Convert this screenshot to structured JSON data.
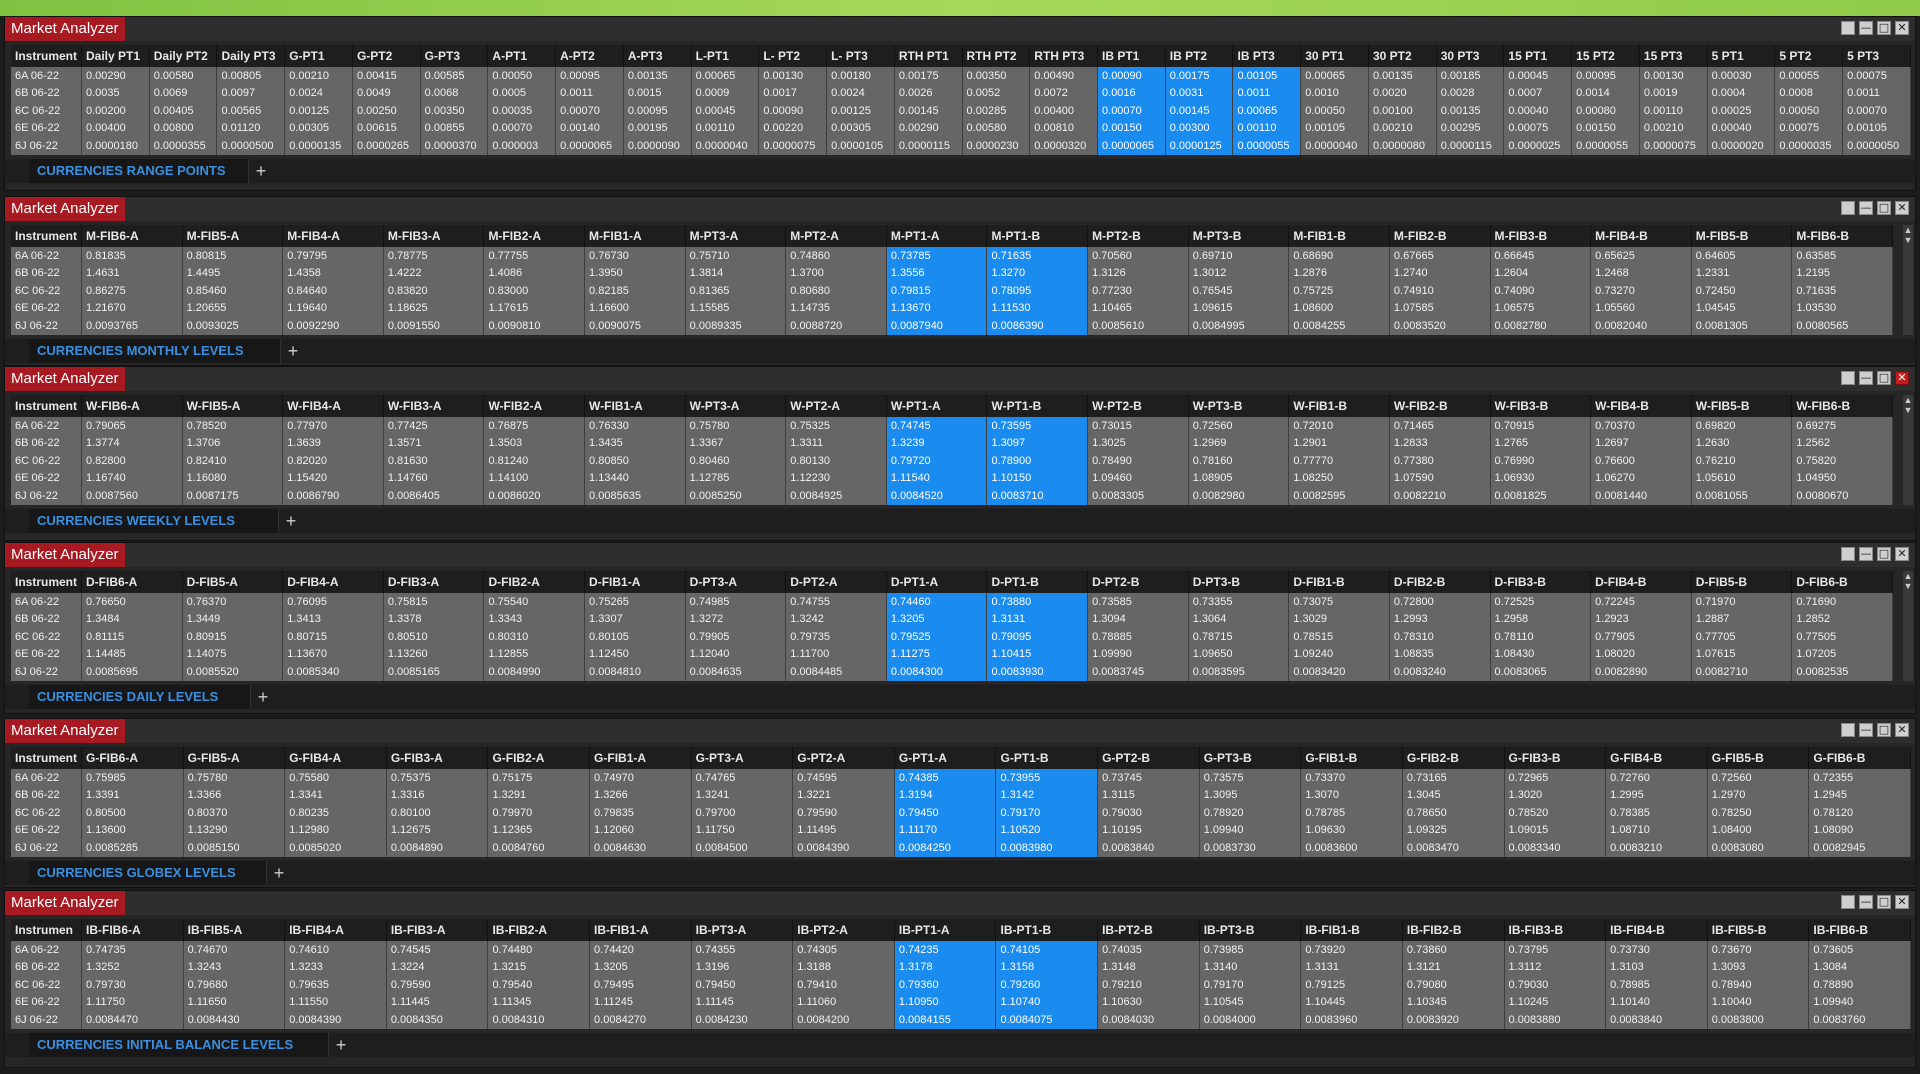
{
  "window_title": "Market Analyzer",
  "window_buttons": [
    "restore-icon",
    "minimize-icon",
    "maximize-icon",
    "close-icon"
  ],
  "panels": [
    {
      "tab": "CURRENCIES RANGE POINTS",
      "columns": [
        "Instrument",
        "Daily PT1",
        "Daily PT2",
        "Daily PT3",
        "G-PT1",
        "G-PT2",
        "G-PT3",
        "A-PT1",
        "A-PT2",
        "A-PT3",
        "L-PT1",
        "L- PT2",
        "L- PT3",
        "RTH PT1",
        "RTH PT2",
        "RTH PT3",
        "IB PT1",
        "IB PT2",
        "IB PT3",
        "30 PT1",
        "30 PT2",
        "30 PT3",
        "15 PT1",
        "15 PT2",
        "15 PT3",
        "5 PT1",
        "5 PT2",
        "5 PT3"
      ],
      "highlight_cols": [
        16,
        17,
        18
      ],
      "rows": [
        [
          "6A 06-22",
          "0.00290",
          "0.00580",
          "0.00805",
          "0.00210",
          "0.00415",
          "0.00585",
          "0.00050",
          "0.00095",
          "0.00135",
          "0.00065",
          "0.00130",
          "0.00180",
          "0.00175",
          "0.00350",
          "0.00490",
          "0.00090",
          "0.00175",
          "0.00105",
          "0.00065",
          "0.00135",
          "0.00185",
          "0.00045",
          "0.00095",
          "0.00130",
          "0.00030",
          "0.00055",
          "0.00075"
        ],
        [
          "6B 06-22",
          "0.0035",
          "0.0069",
          "0.0097",
          "0.0024",
          "0.0049",
          "0.0068",
          "0.0005",
          "0.0011",
          "0.0015",
          "0.0009",
          "0.0017",
          "0.0024",
          "0.0026",
          "0.0052",
          "0.0072",
          "0.0016",
          "0.0031",
          "0.0011",
          "0.0010",
          "0.0020",
          "0.0028",
          "0.0007",
          "0.0014",
          "0.0019",
          "0.0004",
          "0.0008",
          "0.0011"
        ],
        [
          "6C 06-22",
          "0.00200",
          "0.00405",
          "0.00565",
          "0.00125",
          "0.00250",
          "0.00350",
          "0.00035",
          "0.00070",
          "0.00095",
          "0.00045",
          "0.00090",
          "0.00125",
          "0.00145",
          "0.00285",
          "0.00400",
          "0.00070",
          "0.00145",
          "0.00065",
          "0.00050",
          "0.00100",
          "0.00135",
          "0.00040",
          "0.00080",
          "0.00110",
          "0.00025",
          "0.00050",
          "0.00070"
        ],
        [
          "6E 06-22",
          "0.00400",
          "0.00800",
          "0.01120",
          "0.00305",
          "0.00615",
          "0.00855",
          "0.00070",
          "0.00140",
          "0.00195",
          "0.00110",
          "0.00220",
          "0.00305",
          "0.00290",
          "0.00580",
          "0.00810",
          "0.00150",
          "0.00300",
          "0.00110",
          "0.00105",
          "0.00210",
          "0.00295",
          "0.00075",
          "0.00150",
          "0.00210",
          "0.00040",
          "0.00075",
          "0.00105"
        ],
        [
          "6J 06-22",
          "0.0000180",
          "0.0000355",
          "0.0000500",
          "0.0000135",
          "0.0000265",
          "0.0000370",
          "0.000003",
          "0.0000065",
          "0.0000090",
          "0.0000040",
          "0.0000075",
          "0.0000105",
          "0.0000115",
          "0.0000230",
          "0.0000320",
          "0.0000065",
          "0.0000125",
          "0.0000055",
          "0.0000040",
          "0.0000080",
          "0.0000115",
          "0.0000025",
          "0.0000055",
          "0.0000075",
          "0.0000020",
          "0.0000035",
          "0.0000050"
        ]
      ]
    },
    {
      "tab": "CURRENCIES MONTHLY LEVELS",
      "columns": [
        "Instrument",
        "M-FIB6-A",
        "M-FIB5-A",
        "M-FIB4-A",
        "M-FIB3-A",
        "M-FIB2-A",
        "M-FIB1-A",
        "M-PT3-A",
        "M-PT2-A",
        "M-PT1-A",
        "M-PT1-B",
        "M-PT2-B",
        "M-PT3-B",
        "M-FIB1-B",
        "M-FIB2-B",
        "M-FIB3-B",
        "M-FIB4-B",
        "M-FIB5-B",
        "M-FIB6-B"
      ],
      "highlight_cols": [
        9,
        10
      ],
      "rows": [
        [
          "6A 06-22",
          "0.81835",
          "0.80815",
          "0.79795",
          "0.78775",
          "0.77755",
          "0.76730",
          "0.75710",
          "0.74860",
          "0.73785",
          "0.71635",
          "0.70560",
          "0.69710",
          "0.68690",
          "0.67665",
          "0.66645",
          "0.65625",
          "0.64605",
          "0.63585"
        ],
        [
          "6B 06-22",
          "1.4631",
          "1.4495",
          "1.4358",
          "1.4222",
          "1.4086",
          "1.3950",
          "1.3814",
          "1.3700",
          "1.3556",
          "1.3270",
          "1.3126",
          "1.3012",
          "1.2876",
          "1.2740",
          "1.2604",
          "1.2468",
          "1.2331",
          "1.2195"
        ],
        [
          "6C 06-22",
          "0.86275",
          "0.85460",
          "0.84640",
          "0.83820",
          "0.83000",
          "0.82185",
          "0.81365",
          "0.80680",
          "0.79815",
          "0.78095",
          "0.77230",
          "0.76545",
          "0.75725",
          "0.74910",
          "0.74090",
          "0.73270",
          "0.72450",
          "0.71635"
        ],
        [
          "6E 06-22",
          "1.21670",
          "1.20655",
          "1.19640",
          "1.18625",
          "1.17615",
          "1.16600",
          "1.15585",
          "1.14735",
          "1.13670",
          "1.11530",
          "1.10465",
          "1.09615",
          "1.08600",
          "1.07585",
          "1.06575",
          "1.05560",
          "1.04545",
          "1.03530"
        ],
        [
          "6J 06-22",
          "0.0093765",
          "0.0093025",
          "0.0092290",
          "0.0091550",
          "0.0090810",
          "0.0090075",
          "0.0089335",
          "0.0088720",
          "0.0087940",
          "0.0086390",
          "0.0085610",
          "0.0084995",
          "0.0084255",
          "0.0083520",
          "0.0082780",
          "0.0082040",
          "0.0081305",
          "0.0080565"
        ]
      ]
    },
    {
      "tab": "CURRENCIES WEEKLY LEVELS",
      "columns": [
        "Instrument",
        "W-FIB6-A",
        "W-FIB5-A",
        "W-FIB4-A",
        "W-FIB3-A",
        "W-FIB2-A",
        "W-FIB1-A",
        "W-PT3-A",
        "W-PT2-A",
        "W-PT1-A",
        "W-PT1-B",
        "W-PT2-B",
        "W-PT3-B",
        "W-FIB1-B",
        "W-FIB2-B",
        "W-FIB3-B",
        "W-FIB4-B",
        "W-FIB5-B",
        "W-FIB6-B"
      ],
      "highlight_cols": [
        9,
        10
      ],
      "rows": [
        [
          "6A 06-22",
          "0.79065",
          "0.78520",
          "0.77970",
          "0.77425",
          "0.76875",
          "0.76330",
          "0.75780",
          "0.75325",
          "0.74745",
          "0.73595",
          "0.73015",
          "0.72560",
          "0.72010",
          "0.71465",
          "0.70915",
          "0.70370",
          "0.69820",
          "0.69275"
        ],
        [
          "6B 06-22",
          "1.3774",
          "1.3706",
          "1.3639",
          "1.3571",
          "1.3503",
          "1.3435",
          "1.3367",
          "1.3311",
          "1.3239",
          "1.3097",
          "1.3025",
          "1.2969",
          "1.2901",
          "1.2833",
          "1.2765",
          "1.2697",
          "1.2630",
          "1.2562"
        ],
        [
          "6C 06-22",
          "0.82800",
          "0.82410",
          "0.82020",
          "0.81630",
          "0.81240",
          "0.80850",
          "0.80460",
          "0.80130",
          "0.79720",
          "0.78900",
          "0.78490",
          "0.78160",
          "0.77770",
          "0.77380",
          "0.76990",
          "0.76600",
          "0.76210",
          "0.75820"
        ],
        [
          "6E 06-22",
          "1.16740",
          "1.16080",
          "1.15420",
          "1.14760",
          "1.14100",
          "1.13440",
          "1.12785",
          "1.12230",
          "1.11540",
          "1.10150",
          "1.09460",
          "1.08905",
          "1.08250",
          "1.07590",
          "1.06930",
          "1.06270",
          "1.05610",
          "1.04950"
        ],
        [
          "6J 06-22",
          "0.0087560",
          "0.0087175",
          "0.0086790",
          "0.0086405",
          "0.0086020",
          "0.0085635",
          "0.0085250",
          "0.0084925",
          "0.0084520",
          "0.0083710",
          "0.0083305",
          "0.0082980",
          "0.0082595",
          "0.0082210",
          "0.0081825",
          "0.0081440",
          "0.0081055",
          "0.0080670"
        ]
      ]
    },
    {
      "tab": "CURRENCIES DAILY LEVELS",
      "columns": [
        "Instrument",
        "D-FIB6-A",
        "D-FIB5-A",
        "D-FIB4-A",
        "D-FIB3-A",
        "D-FIB2-A",
        "D-FIB1-A",
        "D-PT3-A",
        "D-PT2-A",
        "D-PT1-A",
        "D-PT1-B",
        "D-PT2-B",
        "D-PT3-B",
        "D-FIB1-B",
        "D-FIB2-B",
        "D-FIB3-B",
        "D-FIB4-B",
        "D-FIB5-B",
        "D-FIB6-B"
      ],
      "highlight_cols": [
        9,
        10
      ],
      "rows": [
        [
          "6A 06-22",
          "0.76650",
          "0.76370",
          "0.76095",
          "0.75815",
          "0.75540",
          "0.75265",
          "0.74985",
          "0.74755",
          "0.74460",
          "0.73880",
          "0.73585",
          "0.73355",
          "0.73075",
          "0.72800",
          "0.72525",
          "0.72245",
          "0.71970",
          "0.71690"
        ],
        [
          "6B 06-22",
          "1.3484",
          "1.3449",
          "1.3413",
          "1.3378",
          "1.3343",
          "1.3307",
          "1.3272",
          "1.3242",
          "1.3205",
          "1.3131",
          "1.3094",
          "1.3064",
          "1.3029",
          "1.2993",
          "1.2958",
          "1.2923",
          "1.2887",
          "1.2852"
        ],
        [
          "6C 06-22",
          "0.81115",
          "0.80915",
          "0.80715",
          "0.80510",
          "0.80310",
          "0.80105",
          "0.79905",
          "0.79735",
          "0.79525",
          "0.79095",
          "0.78885",
          "0.78715",
          "0.78515",
          "0.78310",
          "0.78110",
          "0.77905",
          "0.77705",
          "0.77505"
        ],
        [
          "6E 06-22",
          "1.14485",
          "1.14075",
          "1.13670",
          "1.13260",
          "1.12855",
          "1.12450",
          "1.12040",
          "1.11700",
          "1.11275",
          "1.10415",
          "1.09990",
          "1.09650",
          "1.09240",
          "1.08835",
          "1.08430",
          "1.08020",
          "1.07615",
          "1.07205"
        ],
        [
          "6J 06-22",
          "0.0085695",
          "0.0085520",
          "0.0085340",
          "0.0085165",
          "0.0084990",
          "0.0084810",
          "0.0084635",
          "0.0084485",
          "0.0084300",
          "0.0083930",
          "0.0083745",
          "0.0083595",
          "0.0083420",
          "0.0083240",
          "0.0083065",
          "0.0082890",
          "0.0082710",
          "0.0082535"
        ]
      ]
    },
    {
      "tab": "CURRENCIES GLOBEX LEVELS",
      "columns": [
        "Instrument",
        "G-FIB6-A",
        "G-FIB5-A",
        "G-FIB4-A",
        "G-FIB3-A",
        "G-FIB2-A",
        "G-FIB1-A",
        "G-PT3-A",
        "G-PT2-A",
        "G-PT1-A",
        "G-PT1-B",
        "G-PT2-B",
        "G-PT3-B",
        "G-FIB1-B",
        "G-FIB2-B",
        "G-FIB3-B",
        "G-FIB4-B",
        "G-FIB5-B",
        "G-FIB6-B"
      ],
      "highlight_cols": [
        9,
        10
      ],
      "rows": [
        [
          "6A 06-22",
          "0.75985",
          "0.75780",
          "0.75580",
          "0.75375",
          "0.75175",
          "0.74970",
          "0.74765",
          "0.74595",
          "0.74385",
          "0.73955",
          "0.73745",
          "0.73575",
          "0.73370",
          "0.73165",
          "0.72965",
          "0.72760",
          "0.72560",
          "0.72355"
        ],
        [
          "6B 06-22",
          "1.3391",
          "1.3366",
          "1.3341",
          "1.3316",
          "1.3291",
          "1.3266",
          "1.3241",
          "1.3221",
          "1.3194",
          "1.3142",
          "1.3115",
          "1.3095",
          "1.3070",
          "1.3045",
          "1.3020",
          "1.2995",
          "1.2970",
          "1.2945"
        ],
        [
          "6C 06-22",
          "0.80500",
          "0.80370",
          "0.80235",
          "0.80100",
          "0.79970",
          "0.79835",
          "0.79700",
          "0.79590",
          "0.79450",
          "0.79170",
          "0.79030",
          "0.78920",
          "0.78785",
          "0.78650",
          "0.78520",
          "0.78385",
          "0.78250",
          "0.78120"
        ],
        [
          "6E 06-22",
          "1.13600",
          "1.13290",
          "1.12980",
          "1.12675",
          "1.12365",
          "1.12060",
          "1.11750",
          "1.11495",
          "1.11170",
          "1.10520",
          "1.10195",
          "1.09940",
          "1.09630",
          "1.09325",
          "1.09015",
          "1.08710",
          "1.08400",
          "1.08090"
        ],
        [
          "6J 06-22",
          "0.0085285",
          "0.0085150",
          "0.0085020",
          "0.0084890",
          "0.0084760",
          "0.0084630",
          "0.0084500",
          "0.0084390",
          "0.0084250",
          "0.0083980",
          "0.0083840",
          "0.0083730",
          "0.0083600",
          "0.0083470",
          "0.0083340",
          "0.0083210",
          "0.0083080",
          "0.0082945"
        ]
      ]
    },
    {
      "tab": "CURRENCIES INITIAL BALANCE LEVELS",
      "columns": [
        "Instrumen",
        "IB-FIB6-A",
        "IB-FIB5-A",
        "IB-FIB4-A",
        "IB-FIB3-A",
        "IB-FIB2-A",
        "IB-FIB1-A",
        "IB-PT3-A",
        "IB-PT2-A",
        "IB-PT1-A",
        "IB-PT1-B",
        "IB-PT2-B",
        "IB-PT3-B",
        "IB-FIB1-B",
        "IB-FIB2-B",
        "IB-FIB3-B",
        "IB-FIB4-B",
        "IB-FIB5-B",
        "IB-FIB6-B"
      ],
      "highlight_cols": [
        9,
        10
      ],
      "rows": [
        [
          "6A 06-22",
          "0.74735",
          "0.74670",
          "0.74610",
          "0.74545",
          "0.74480",
          "0.74420",
          "0.74355",
          "0.74305",
          "0.74235",
          "0.74105",
          "0.74035",
          "0.73985",
          "0.73920",
          "0.73860",
          "0.73795",
          "0.73730",
          "0.73670",
          "0.73605"
        ],
        [
          "6B 06-22",
          "1.3252",
          "1.3243",
          "1.3233",
          "1.3224",
          "1.3215",
          "1.3205",
          "1.3196",
          "1.3188",
          "1.3178",
          "1.3158",
          "1.3148",
          "1.3140",
          "1.3131",
          "1.3121",
          "1.3112",
          "1.3103",
          "1.3093",
          "1.3084"
        ],
        [
          "6C 06-22",
          "0.79730",
          "0.79680",
          "0.79635",
          "0.79590",
          "0.79540",
          "0.79495",
          "0.79450",
          "0.79410",
          "0.79360",
          "0.79260",
          "0.79210",
          "0.79170",
          "0.79125",
          "0.79080",
          "0.79030",
          "0.78985",
          "0.78940",
          "0.78890"
        ],
        [
          "6E 06-22",
          "1.11750",
          "1.11650",
          "1.11550",
          "1.11445",
          "1.11345",
          "1.11245",
          "1.11145",
          "1.11060",
          "1.10950",
          "1.10740",
          "1.10630",
          "1.10545",
          "1.10445",
          "1.10345",
          "1.10245",
          "1.10140",
          "1.10040",
          "1.09940"
        ],
        [
          "6J 06-22",
          "0.0084470",
          "0.0084430",
          "0.0084390",
          "0.0084350",
          "0.0084310",
          "0.0084270",
          "0.0084230",
          "0.0084200",
          "0.0084155",
          "0.0084075",
          "0.0084030",
          "0.0084000",
          "0.0083960",
          "0.0083920",
          "0.0083880",
          "0.0083840",
          "0.0083800",
          "0.0083760"
        ]
      ]
    }
  ]
}
